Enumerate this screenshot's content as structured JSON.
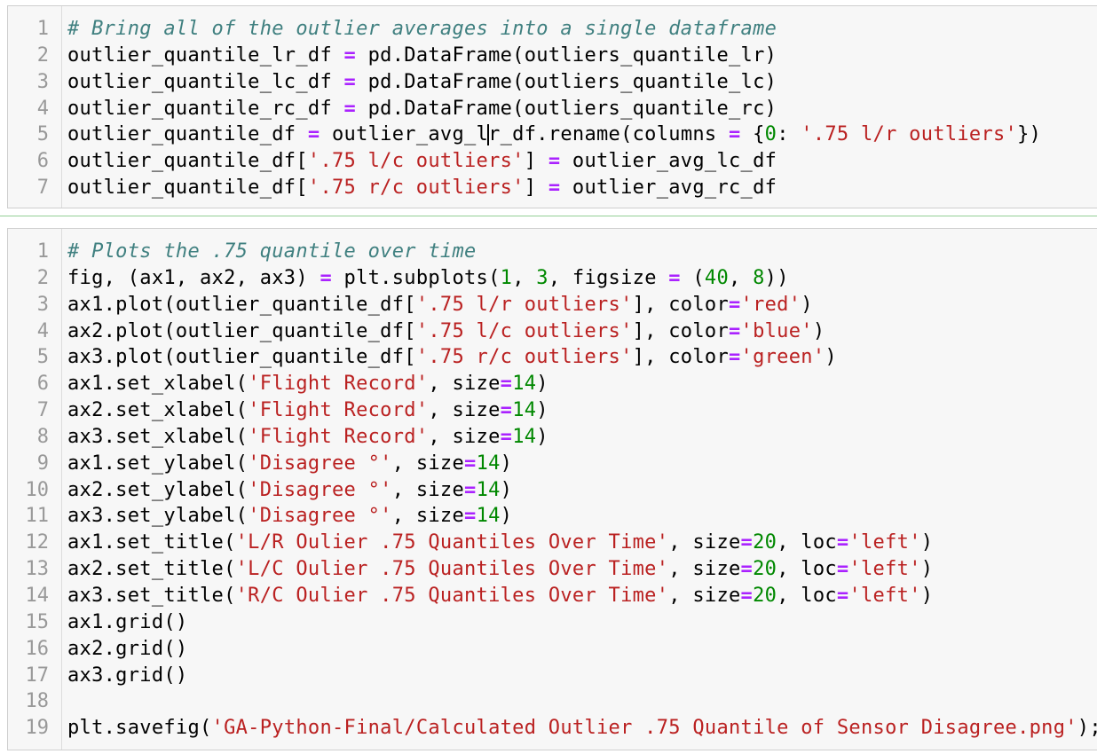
{
  "cell1": {
    "line_numbers": [
      "1",
      "2",
      "3",
      "4",
      "5",
      "6",
      "7"
    ],
    "lines": [
      [
        {
          "t": "# Bring all of the outlier averages into a single dataframe",
          "c": "cm"
        }
      ],
      [
        {
          "t": "outlier_quantile_lr_df "
        },
        {
          "t": "=",
          "c": "o"
        },
        {
          "t": " pd.DataFrame(outliers_quantile_lr)"
        }
      ],
      [
        {
          "t": "outlier_quantile_lc_df "
        },
        {
          "t": "=",
          "c": "o"
        },
        {
          "t": " pd.DataFrame(outliers_quantile_lc)"
        }
      ],
      [
        {
          "t": "outlier_quantile_rc_df "
        },
        {
          "t": "=",
          "c": "o"
        },
        {
          "t": " pd.DataFrame(outliers_quantile_rc)"
        }
      ],
      [
        {
          "t": "outlier_quantile_df "
        },
        {
          "t": "=",
          "c": "o"
        },
        {
          "t": " outlier_avg_l"
        },
        {
          "t": "",
          "c": "cursor"
        },
        {
          "t": "r_df.rename(columns "
        },
        {
          "t": "=",
          "c": "o"
        },
        {
          "t": " {"
        },
        {
          "t": "0",
          "c": "n"
        },
        {
          "t": ": "
        },
        {
          "t": "'.75 l/r outliers'",
          "c": "s"
        },
        {
          "t": "})"
        }
      ],
      [
        {
          "t": "outlier_quantile_df["
        },
        {
          "t": "'.75 l/c outliers'",
          "c": "s"
        },
        {
          "t": "] "
        },
        {
          "t": "=",
          "c": "o"
        },
        {
          "t": " outlier_avg_lc_df"
        }
      ],
      [
        {
          "t": "outlier_quantile_df["
        },
        {
          "t": "'.75 r/c outliers'",
          "c": "s"
        },
        {
          "t": "] "
        },
        {
          "t": "=",
          "c": "o"
        },
        {
          "t": " outlier_avg_rc_df"
        }
      ]
    ]
  },
  "cell2": {
    "line_numbers": [
      "1",
      "2",
      "3",
      "4",
      "5",
      "6",
      "7",
      "8",
      "9",
      "10",
      "11",
      "12",
      "13",
      "14",
      "15",
      "16",
      "17",
      "18",
      "19"
    ],
    "lines": [
      [
        {
          "t": "# Plots the .75 quantile over time",
          "c": "cm"
        }
      ],
      [
        {
          "t": "fig, (ax1, ax2, ax3) "
        },
        {
          "t": "=",
          "c": "o"
        },
        {
          "t": " plt.subplots("
        },
        {
          "t": "1",
          "c": "n"
        },
        {
          "t": ", "
        },
        {
          "t": "3",
          "c": "n"
        },
        {
          "t": ", figsize "
        },
        {
          "t": "=",
          "c": "o"
        },
        {
          "t": " ("
        },
        {
          "t": "40",
          "c": "n"
        },
        {
          "t": ", "
        },
        {
          "t": "8",
          "c": "n"
        },
        {
          "t": "))"
        }
      ],
      [
        {
          "t": "ax1.plot(outlier_quantile_df["
        },
        {
          "t": "'.75 l/r outliers'",
          "c": "s"
        },
        {
          "t": "], color"
        },
        {
          "t": "=",
          "c": "o"
        },
        {
          "t": "'red'",
          "c": "s"
        },
        {
          "t": ")"
        }
      ],
      [
        {
          "t": "ax2.plot(outlier_quantile_df["
        },
        {
          "t": "'.75 l/c outliers'",
          "c": "s"
        },
        {
          "t": "], color"
        },
        {
          "t": "=",
          "c": "o"
        },
        {
          "t": "'blue'",
          "c": "s"
        },
        {
          "t": ")"
        }
      ],
      [
        {
          "t": "ax3.plot(outlier_quantile_df["
        },
        {
          "t": "'.75 r/c outliers'",
          "c": "s"
        },
        {
          "t": "], color"
        },
        {
          "t": "=",
          "c": "o"
        },
        {
          "t": "'green'",
          "c": "s"
        },
        {
          "t": ")"
        }
      ],
      [
        {
          "t": "ax1.set_xlabel("
        },
        {
          "t": "'Flight Record'",
          "c": "s"
        },
        {
          "t": ", size"
        },
        {
          "t": "=",
          "c": "o"
        },
        {
          "t": "14",
          "c": "n"
        },
        {
          "t": ")"
        }
      ],
      [
        {
          "t": "ax2.set_xlabel("
        },
        {
          "t": "'Flight Record'",
          "c": "s"
        },
        {
          "t": ", size"
        },
        {
          "t": "=",
          "c": "o"
        },
        {
          "t": "14",
          "c": "n"
        },
        {
          "t": ")"
        }
      ],
      [
        {
          "t": "ax3.set_xlabel("
        },
        {
          "t": "'Flight Record'",
          "c": "s"
        },
        {
          "t": ", size"
        },
        {
          "t": "=",
          "c": "o"
        },
        {
          "t": "14",
          "c": "n"
        },
        {
          "t": ")"
        }
      ],
      [
        {
          "t": "ax1.set_ylabel("
        },
        {
          "t": "'Disagree °'",
          "c": "s"
        },
        {
          "t": ", size"
        },
        {
          "t": "=",
          "c": "o"
        },
        {
          "t": "14",
          "c": "n"
        },
        {
          "t": ")"
        }
      ],
      [
        {
          "t": "ax2.set_ylabel("
        },
        {
          "t": "'Disagree °'",
          "c": "s"
        },
        {
          "t": ", size"
        },
        {
          "t": "=",
          "c": "o"
        },
        {
          "t": "14",
          "c": "n"
        },
        {
          "t": ")"
        }
      ],
      [
        {
          "t": "ax3.set_ylabel("
        },
        {
          "t": "'Disagree °'",
          "c": "s"
        },
        {
          "t": ", size"
        },
        {
          "t": "=",
          "c": "o"
        },
        {
          "t": "14",
          "c": "n"
        },
        {
          "t": ")"
        }
      ],
      [
        {
          "t": "ax1.set_title("
        },
        {
          "t": "'L/R Oulier .75 Quantiles Over Time'",
          "c": "s"
        },
        {
          "t": ", size"
        },
        {
          "t": "=",
          "c": "o"
        },
        {
          "t": "20",
          "c": "n"
        },
        {
          "t": ", loc"
        },
        {
          "t": "=",
          "c": "o"
        },
        {
          "t": "'left'",
          "c": "s"
        },
        {
          "t": ")"
        }
      ],
      [
        {
          "t": "ax2.set_title("
        },
        {
          "t": "'L/C Oulier .75 Quantiles Over Time'",
          "c": "s"
        },
        {
          "t": ", size"
        },
        {
          "t": "=",
          "c": "o"
        },
        {
          "t": "20",
          "c": "n"
        },
        {
          "t": ", loc"
        },
        {
          "t": "=",
          "c": "o"
        },
        {
          "t": "'left'",
          "c": "s"
        },
        {
          "t": ")"
        }
      ],
      [
        {
          "t": "ax3.set_title("
        },
        {
          "t": "'R/C Oulier .75 Quantiles Over Time'",
          "c": "s"
        },
        {
          "t": ", size"
        },
        {
          "t": "=",
          "c": "o"
        },
        {
          "t": "20",
          "c": "n"
        },
        {
          "t": ", loc"
        },
        {
          "t": "=",
          "c": "o"
        },
        {
          "t": "'left'",
          "c": "s"
        },
        {
          "t": ")"
        }
      ],
      [
        {
          "t": "ax1.grid()"
        }
      ],
      [
        {
          "t": "ax2.grid()"
        }
      ],
      [
        {
          "t": "ax3.grid()"
        }
      ],
      [
        {
          "t": ""
        }
      ],
      [
        {
          "t": "plt.savefig("
        },
        {
          "t": "'GA-Python-Final/Calculated Outlier .75 Quantile of Sensor Disagree.png'",
          "c": "s"
        },
        {
          "t": ");"
        }
      ]
    ]
  }
}
